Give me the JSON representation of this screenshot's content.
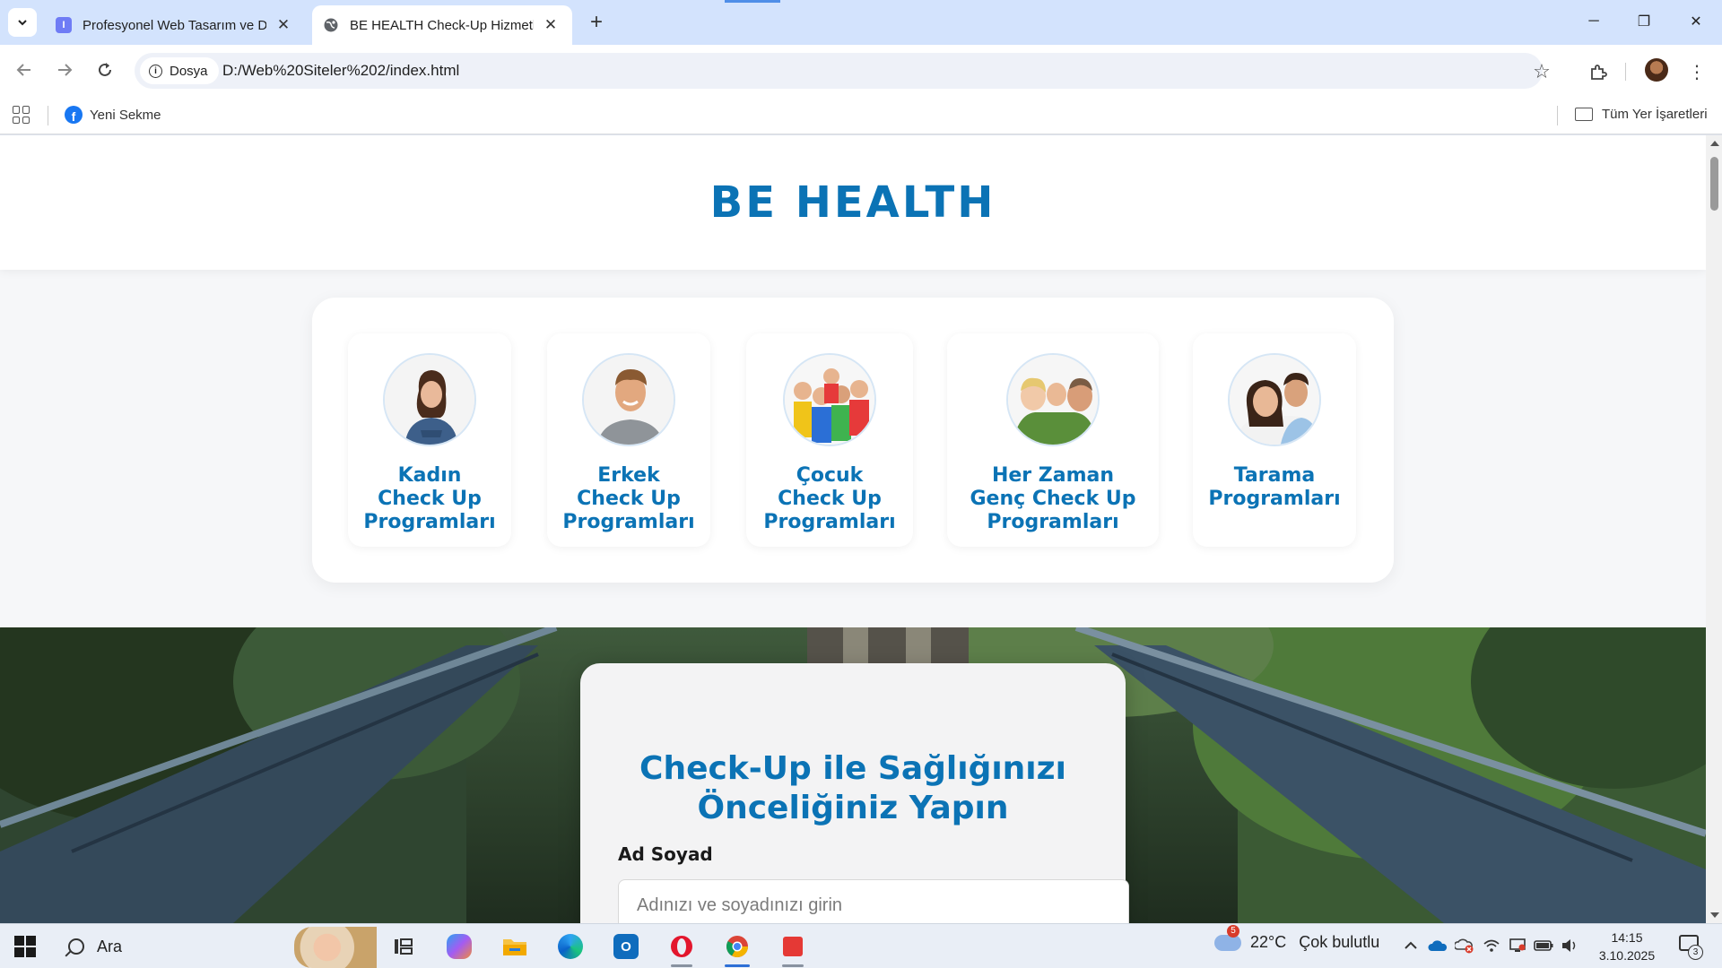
{
  "browser": {
    "tabs": [
      {
        "title": "Profesyonel Web Tasarım ve Dij",
        "active": false,
        "favicon_color": "#6f7cf5"
      },
      {
        "title": "BE HEALTH Check-Up Hizmetler",
        "active": true,
        "favicon_color": "#5f6368"
      }
    ],
    "new_tab_symbol": "+",
    "close_symbol": "✕",
    "window_controls": {
      "minimize": "─",
      "restore": "❐",
      "close": "✕"
    },
    "site_chip": "Dosya",
    "url": "D:/Web%20Siteler%202/index.html",
    "bookmarks": [
      {
        "label": "Yeni Sekme",
        "icon": "facebook-icon"
      }
    ],
    "all_bookmarks": "Tüm Yer İşaretleri"
  },
  "page": {
    "logo": "BE HEALTH",
    "programs": [
      {
        "label": "Kadın Check Up Programları",
        "photo": "woman-photo"
      },
      {
        "label": "Erkek Check Up Programları",
        "photo": "man-photo"
      },
      {
        "label": "Çocuk Check Up Programları",
        "photo": "children-photo"
      },
      {
        "label": "Her Zaman Genç Check Up Programları",
        "photo": "family-photo"
      },
      {
        "label": "Tarama Programları",
        "photo": "couple-photo"
      }
    ],
    "form": {
      "title": "Check-Up ile Sağlığınızı Önceliğiniz Yapın",
      "name_label": "Ad Soyad",
      "name_placeholder": "Adınızı ve soyadınızı girin",
      "name_value": ""
    },
    "colors": {
      "brand": "#0b73b5"
    }
  },
  "taskbar": {
    "search_label": "Ara",
    "weather": {
      "temp": "22°C",
      "desc": "Çok bulutlu",
      "badge": "5"
    },
    "time": "14:15",
    "date": "3.10.2025",
    "notifications": "3"
  }
}
